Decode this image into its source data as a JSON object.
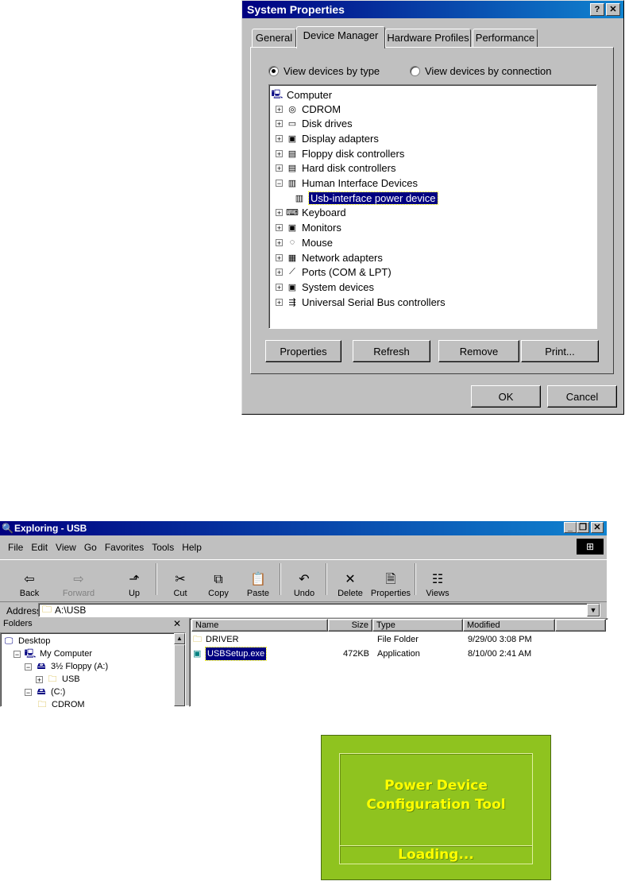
{
  "system_properties": {
    "title": "System Properties",
    "tabs": [
      "General",
      "Device Manager",
      "Hardware Profiles",
      "Performance"
    ],
    "active_tab": "Device Manager",
    "radio_by_type": "View devices by type",
    "radio_by_connection": "View devices by connection",
    "tree": {
      "root": "Computer",
      "items": [
        {
          "label": "CDROM",
          "icon": "cdrom-icon",
          "glyph": "◎"
        },
        {
          "label": "Disk drives",
          "icon": "disk-drive-icon",
          "glyph": "▭"
        },
        {
          "label": "Display adapters",
          "icon": "display-adapter-icon",
          "glyph": "▣"
        },
        {
          "label": "Floppy disk controllers",
          "icon": "floppy-controller-icon",
          "glyph": "▤"
        },
        {
          "label": "Hard disk controllers",
          "icon": "hard-disk-controller-icon",
          "glyph": "▤"
        },
        {
          "label": "Human Interface Devices",
          "icon": "hid-icon",
          "glyph": "▥"
        },
        {
          "label": "Usb-interface power device",
          "icon": "hid-device-icon",
          "glyph": "▥"
        },
        {
          "label": "Keyboard",
          "icon": "keyboard-icon",
          "glyph": "⌨"
        },
        {
          "label": "Monitors",
          "icon": "monitor-icon",
          "glyph": "▣"
        },
        {
          "label": "Mouse",
          "icon": "mouse-icon",
          "glyph": "◌"
        },
        {
          "label": "Network adapters",
          "icon": "network-adapter-icon",
          "glyph": "▦"
        },
        {
          "label": "Ports (COM & LPT)",
          "icon": "port-icon",
          "glyph": "⟋"
        },
        {
          "label": "System devices",
          "icon": "system-device-icon",
          "glyph": "▣"
        },
        {
          "label": "Universal Serial Bus controllers",
          "icon": "usb-icon",
          "glyph": "⇶"
        }
      ]
    },
    "buttons": {
      "properties": "Properties",
      "refresh": "Refresh",
      "remove": "Remove",
      "print": "Print...",
      "ok": "OK",
      "cancel": "Cancel"
    }
  },
  "explorer": {
    "title": "Exploring - USB",
    "menu": [
      "File",
      "Edit",
      "View",
      "Go",
      "Favorites",
      "Tools",
      "Help"
    ],
    "toolbar": [
      {
        "label": "Back",
        "glyph": "⇦"
      },
      {
        "label": "Forward",
        "glyph": "⇨"
      },
      {
        "label": "Up",
        "glyph": "⬏"
      },
      {
        "label": "Cut",
        "glyph": "✂"
      },
      {
        "label": "Copy",
        "glyph": "⧉"
      },
      {
        "label": "Paste",
        "glyph": "📋"
      },
      {
        "label": "Undo",
        "glyph": "↶"
      },
      {
        "label": "Delete",
        "glyph": "✕"
      },
      {
        "label": "Properties",
        "glyph": "🗎"
      },
      {
        "label": "Views",
        "glyph": "☷"
      }
    ],
    "address_label": "Address",
    "address_value": "A:\\USB",
    "folders_header": "Folders",
    "folders": [
      {
        "label": "Desktop",
        "level": 0
      },
      {
        "label": "My Computer",
        "level": 1
      },
      {
        "label": "3½ Floppy (A:)",
        "level": 2
      },
      {
        "label": "USB",
        "level": 3
      },
      {
        "label": "(C:)",
        "level": 2
      },
      {
        "label": "CDROM",
        "level": 3
      }
    ],
    "columns": [
      "Name",
      "Size",
      "Type",
      "Modified"
    ],
    "files": [
      {
        "name": "DRIVER",
        "size": "",
        "type": "File Folder",
        "modified": "9/29/00 3:08 PM"
      },
      {
        "name": "USBSetup.exe",
        "size": "472KB",
        "type": "Application",
        "modified": "8/10/00 2:41 AM"
      }
    ]
  },
  "splash": {
    "title_line1": "Power Device",
    "title_line2": "Configuration Tool",
    "status": "Loading..."
  }
}
